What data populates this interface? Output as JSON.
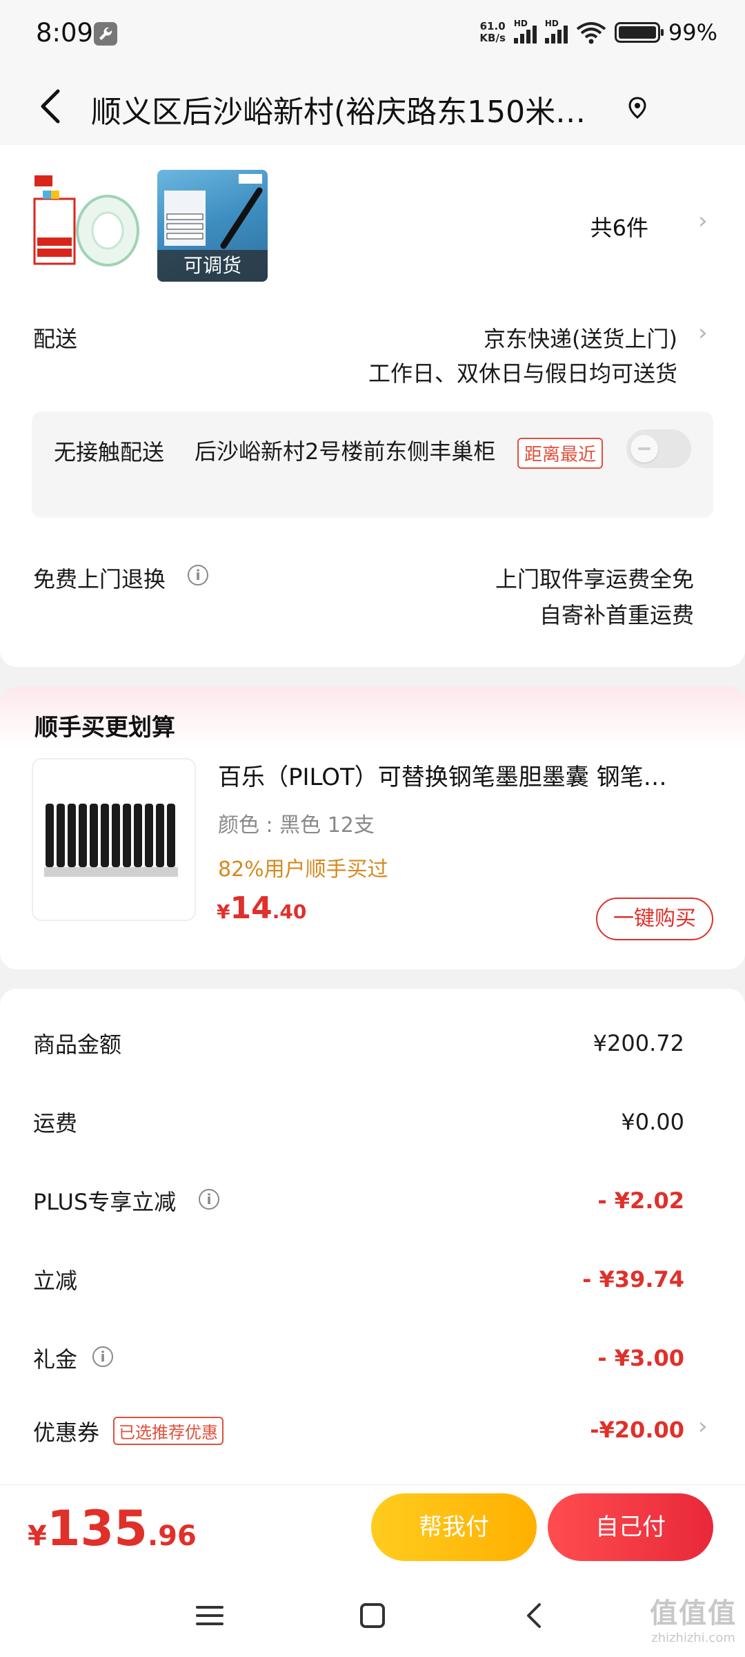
{
  "status_bar": {
    "time": "8:09",
    "net_speed_value": "61.0",
    "net_speed_unit": "KB/s",
    "hd_label": "HD",
    "battery_pct": "99%"
  },
  "header": {
    "title": "顺义区后沙峪新村(裕庆路东150米…"
  },
  "order": {
    "thumb2_badge": "可调货",
    "item_count": "共6件",
    "delivery_label": "配送",
    "delivery_method": "京东快递(送货上门)",
    "delivery_schedule": "工作日、双休日与假日均可送货",
    "contactless_label": "无接触配送",
    "contactless_address": "后沙峪新村2号楼前东侧丰巢柜",
    "nearest_badge": "距离最近",
    "return_label": "免费上门退换",
    "return_line1": "上门取件享运费全免",
    "return_line2": "自寄补首重运费"
  },
  "addon": {
    "section_title": "顺手买更划算",
    "product_title": "百乐（PILOT）可替换钢笔墨胆墨囊 钢笔…",
    "spec": "颜色 : 黑色 12支",
    "buyers": "82%用户顺手买过",
    "price_currency": "¥",
    "price_int": "14",
    "price_dec": ".40",
    "buy_button": "一键购买"
  },
  "fees": [
    {
      "label": "商品金额",
      "value": "¥200.72"
    },
    {
      "label": "运费",
      "value": "¥0.00"
    },
    {
      "label": "PLUS专享立减",
      "value": "- ¥2.02"
    },
    {
      "label": "立减",
      "value": "- ¥39.74"
    },
    {
      "label": "礼金",
      "value": "- ¥3.00"
    },
    {
      "label": "优惠券",
      "value": "-¥20.00",
      "badge": "已选推荐优惠"
    }
  ],
  "pay": {
    "currency": "¥",
    "total_int": "135",
    "total_dec": ".96",
    "help_pay": "帮我付",
    "self_pay": "自己付"
  },
  "watermark": {
    "big": "值值值",
    "small": "zhizhizhi.com"
  },
  "colors": {
    "accent_red": "#e0302a",
    "accent_yellow": "#ffb000",
    "addon_buyers": "#d48a1f"
  }
}
